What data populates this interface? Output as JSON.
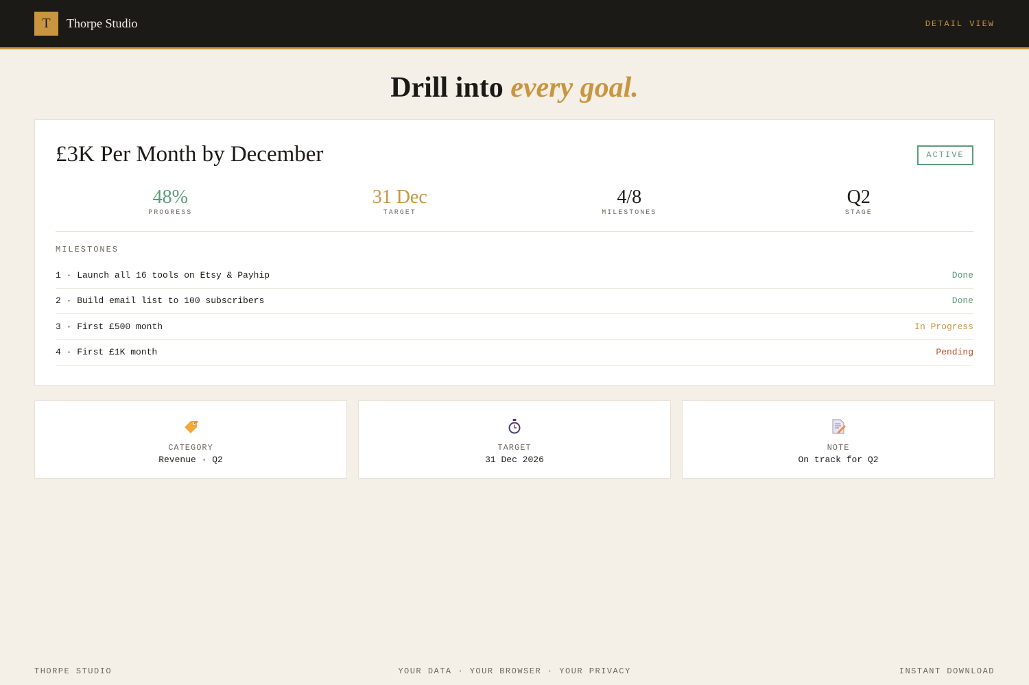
{
  "header": {
    "logo_letter": "T",
    "brand": "Thorpe Studio",
    "nav_label": "DETAIL VIEW"
  },
  "headline": {
    "prefix": "Drill into",
    "accent": "every goal."
  },
  "goal": {
    "title": "£3K Per Month by December",
    "status": "ACTIVE",
    "stats": [
      {
        "value": "48%",
        "label": "PROGRESS",
        "color": "#5a9c78"
      },
      {
        "value": "31 Dec",
        "label": "TARGET",
        "color": "#c8963e"
      },
      {
        "value": "4/8",
        "label": "MILESTONES",
        "color": "#1c1a17"
      },
      {
        "value": "Q2",
        "label": "STAGE",
        "color": "#1c1a17"
      }
    ],
    "milestones_label": "MILESTONES",
    "milestones": [
      {
        "text": "1 · Launch all 16 tools on Etsy & Payhip",
        "status": "Done",
        "color": "#5a9c78"
      },
      {
        "text": "2 · Build email list to 100 subscribers",
        "status": "Done",
        "color": "#5a9c78"
      },
      {
        "text": "3 · First £500 month",
        "status": "In Progress",
        "color": "#c8963e"
      },
      {
        "text": "4 · First £1K month",
        "status": "Pending",
        "color": "#c0502a"
      }
    ]
  },
  "info_cards": [
    {
      "icon": "tag-icon",
      "label": "CATEGORY",
      "value": "Revenue · Q2"
    },
    {
      "icon": "stopwatch-icon",
      "label": "TARGET",
      "value": "31 Dec 2026"
    },
    {
      "icon": "memo-icon",
      "label": "NOTE",
      "value": "On track for Q2"
    }
  ],
  "footer": {
    "left": "THORPE STUDIO",
    "center": "YOUR DATA · YOUR BROWSER · YOUR PRIVACY",
    "right": "INSTANT DOWNLOAD"
  },
  "colors": {
    "accent": "#c8963e",
    "done": "#5a9c78",
    "pending": "#c0502a",
    "dark": "#1c1a17",
    "background": "#f4efe7"
  }
}
